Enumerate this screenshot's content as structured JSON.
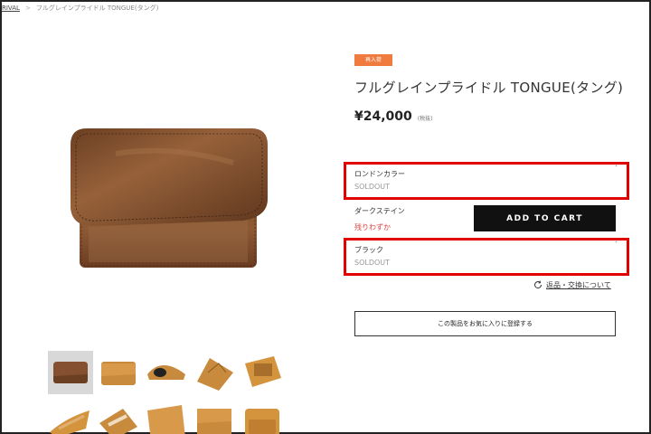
{
  "breadcrumb": {
    "link": "RIVAL",
    "separator": ">",
    "current": "フルグレインプライドル TONGUE(タング)"
  },
  "product": {
    "badge": "再入荷",
    "title": "フルグレインプライドル TONGUE(タング)",
    "price": "¥24,000",
    "tax_note": "(税抜)"
  },
  "variants": [
    {
      "name": "ロンドンカラー",
      "status": "SOLDOUT"
    },
    {
      "name": "ダークステイン",
      "status": "残りわずか"
    },
    {
      "name": "ブラック",
      "status": "SOLDOUT"
    }
  ],
  "actions": {
    "add_to_cart": "ADD TO CART",
    "return_link": "返品・交換について",
    "favorite": "この製品をお気に入りに登録する"
  },
  "icons": {
    "return": "refresh-icon",
    "caret": "caret-up-icon"
  },
  "colors": {
    "badge": "#f07b3f",
    "highlight_border": "#e00000",
    "low_stock": "#e04040",
    "cart_button": "#111111"
  },
  "thumbnails_count": 10
}
